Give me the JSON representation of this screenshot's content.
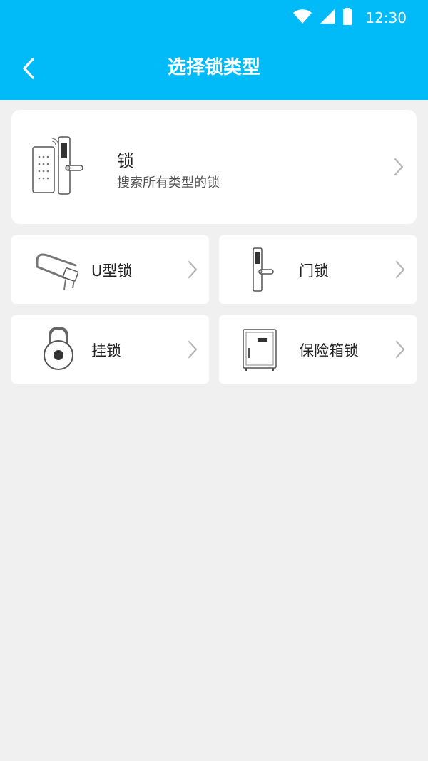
{
  "status_bar": {
    "time": "12:30",
    "icons": [
      "wifi-icon",
      "cell-signal-icon",
      "battery-icon"
    ]
  },
  "app_bar": {
    "title": "选择锁类型",
    "back_icon": "back-arrow-icon"
  },
  "main_card": {
    "title": "锁",
    "subtitle": "搜索所有类型的锁"
  },
  "categories": [
    {
      "label": "U型锁"
    },
    {
      "label": "门锁"
    },
    {
      "label": "挂锁"
    },
    {
      "label": "保险箱锁"
    }
  ],
  "colors": {
    "accent": "#00bbf7",
    "background": "#f0f0f0",
    "card": "#ffffff"
  }
}
